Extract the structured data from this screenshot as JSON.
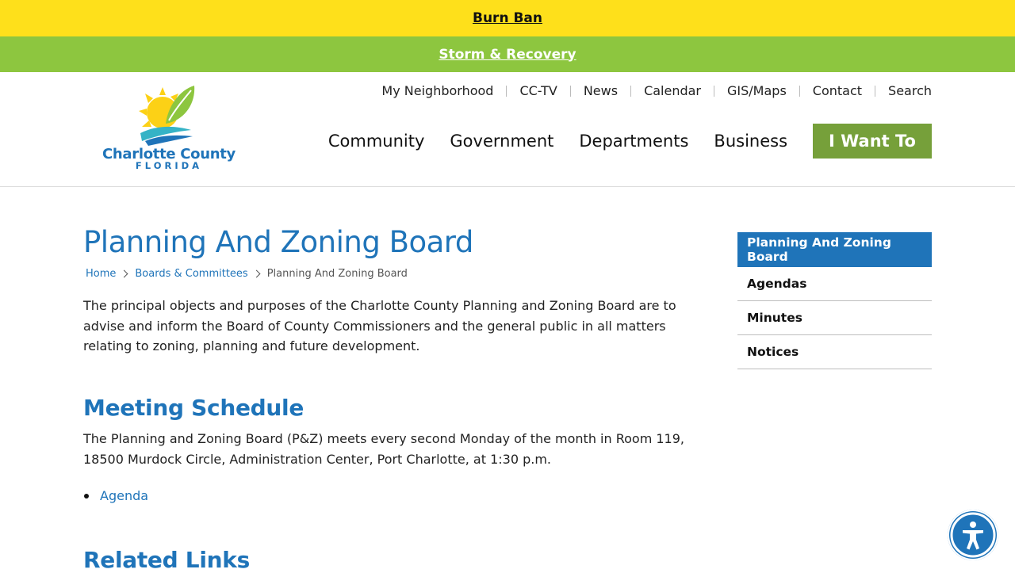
{
  "alerts": {
    "burn_ban": "Burn Ban",
    "storm_recovery": "Storm & Recovery"
  },
  "logo": {
    "line1": "Charlotte County",
    "line2": "FLORIDA"
  },
  "utility_nav": [
    "My Neighborhood",
    "CC-TV",
    "News",
    "Calendar",
    "GIS/Maps",
    "Contact",
    "Search"
  ],
  "main_nav": {
    "community": "Community",
    "government": "Government",
    "departments": "Departments",
    "business": "Business",
    "i_want_to": "I Want To"
  },
  "page": {
    "title": "Planning And Zoning Board",
    "breadcrumb": [
      "Home",
      "Boards & Committees",
      "Planning And Zoning Board"
    ],
    "intro": "The principal objects and purposes of the Charlotte County Planning and Zoning Board are to advise and inform the Board of County Commissioners and the general public in all matters relating to zoning, planning and future development.",
    "meeting_heading": "Meeting Schedule",
    "meeting_text": "The Planning and Zoning Board (P&Z) meets every second Monday of the month in Room 119, 18500 Murdock Circle, Administration Center, Port Charlotte, at 1:30 p.m.",
    "meeting_links": [
      "Agenda"
    ],
    "related_heading": "Related Links"
  },
  "sidebar": [
    "Planning And Zoning Board",
    "Agendas",
    "Minutes",
    "Notices"
  ],
  "colors": {
    "burn_ban_bg": "#fee01b",
    "storm_bg": "#8dc63f",
    "brand_blue": "#1f74b9",
    "i_want_to_bg": "#76a03a"
  }
}
